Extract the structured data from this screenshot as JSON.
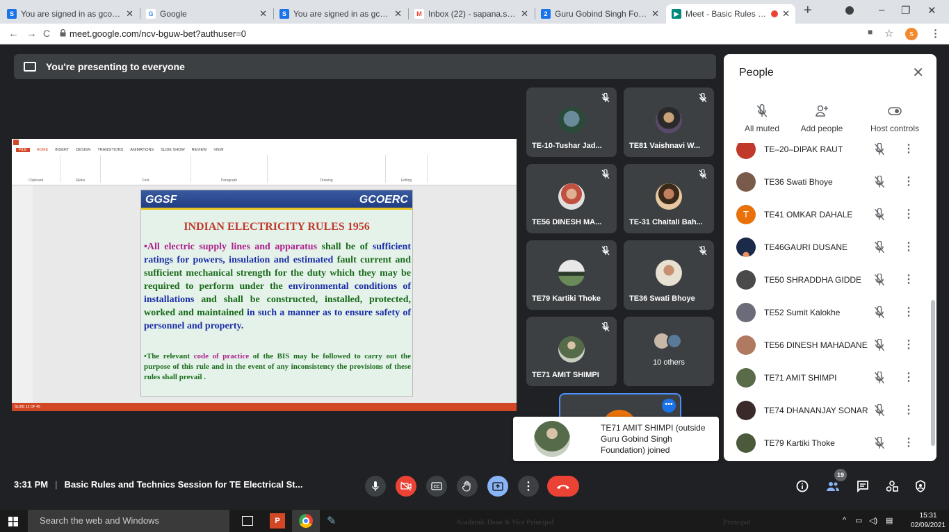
{
  "browser": {
    "tabs": [
      {
        "title": "You are signed in as gcoercstu",
        "favicon": "S",
        "color": "#1a73e8"
      },
      {
        "title": "Google",
        "favicon": "G",
        "color": "#4285f4"
      },
      {
        "title": "You are signed in as gcoercstu",
        "favicon": "S",
        "color": "#1a73e8"
      },
      {
        "title": "Inbox (22) - sapana.sonar@gc",
        "favicon": "M",
        "color": "#ea4335"
      },
      {
        "title": "Guru Gobind Singh Foundation",
        "favicon": "2",
        "color": "#1a73e8"
      },
      {
        "title": "Meet - Basic Rules and Te",
        "favicon": "▶",
        "color": "#00897b"
      }
    ],
    "url": "meet.google.com/ncv-bguw-bet?authuser=0",
    "profile_letter": "s"
  },
  "meet": {
    "presenting_text": "You're presenting to everyone",
    "time": "3:31 PM",
    "meeting_title": "Basic Rules and Technics Session for TE Electrical St...",
    "participant_count": "19",
    "tiles": [
      {
        "name": "TE-10-Tushar Jad..."
      },
      {
        "name": "TE81 Vaishnavi W..."
      },
      {
        "name": "TE56 DINESH MA..."
      },
      {
        "name": "TE-31 Chaitali Bah..."
      },
      {
        "name": "TE79 Kartiki Thoke"
      },
      {
        "name": "TE36 Swati Bhoye"
      },
      {
        "name": "TE71 AMIT SHIMPI"
      },
      {
        "name": "10 others"
      }
    ],
    "toast": "TE71 AMIT SHIMPI (outside Guru Gobind Singh Foundation) joined"
  },
  "slide": {
    "header_left": "GGSF",
    "header_right": "GCOERC",
    "title": "INDIAN ELECTRICITY RULES 1956",
    "p1_a": "•All electric supply lines and apparatus",
    "p1_b": " shall be of ",
    "p1_c": "sufficient ratings for powers, insulation and estimated",
    "p1_d": " fault current and sufficient mechanical strength for the duty which they may be required to perform under the ",
    "p1_e": "environmental conditions of installations",
    "p1_f": " and shall be constructed, installed, protected, worked and maintained ",
    "p1_g": "in such a manner as to ensure safety of personnel and property.",
    "p2_a": "•The relevant ",
    "p2_b": "code of practice",
    "p2_c": " of the BIS may be followed to carry out the purpose of this rule and in the event of any inconsistency the provisions of these rules shall prevail .",
    "status": "SLIDE 12 OF 45"
  },
  "people": {
    "title": "People",
    "actions": {
      "all_muted": "All muted",
      "add_people": "Add people",
      "host_controls": "Host controls"
    },
    "list": [
      {
        "name": "TE–20–DIPAK RAUT",
        "color": "#c0392b"
      },
      {
        "name": "TE36 Swati Bhoye",
        "color": "#7a5a4a"
      },
      {
        "name": "TE41 OMKAR DAHALE",
        "color": "#e8710a",
        "initial": "T"
      },
      {
        "name": "TE46GAURI DUSANE",
        "color": "#1b2a48"
      },
      {
        "name": "TE50 SHRADDHA GIDDE",
        "color": "#4a4a4a"
      },
      {
        "name": "TE52 Sumit Kalokhe",
        "color": "#6b6b7a"
      },
      {
        "name": "TE56 DINESH MAHADANE",
        "color": "#b07a60"
      },
      {
        "name": "TE71 AMIT SHIMPI",
        "color": "#5a6b4a"
      },
      {
        "name": "TE74 DHANANJAY SONAR",
        "color": "#3a2a2a"
      },
      {
        "name": "TE79 Kartiki Thoke",
        "color": "#4a5a3a"
      }
    ]
  },
  "taskbar": {
    "search": "Search the web and Windows",
    "time": "15:31",
    "date": "02/09/2021",
    "behind_left": "Academic Dean & Vice Principal",
    "behind_right": "Principal"
  }
}
